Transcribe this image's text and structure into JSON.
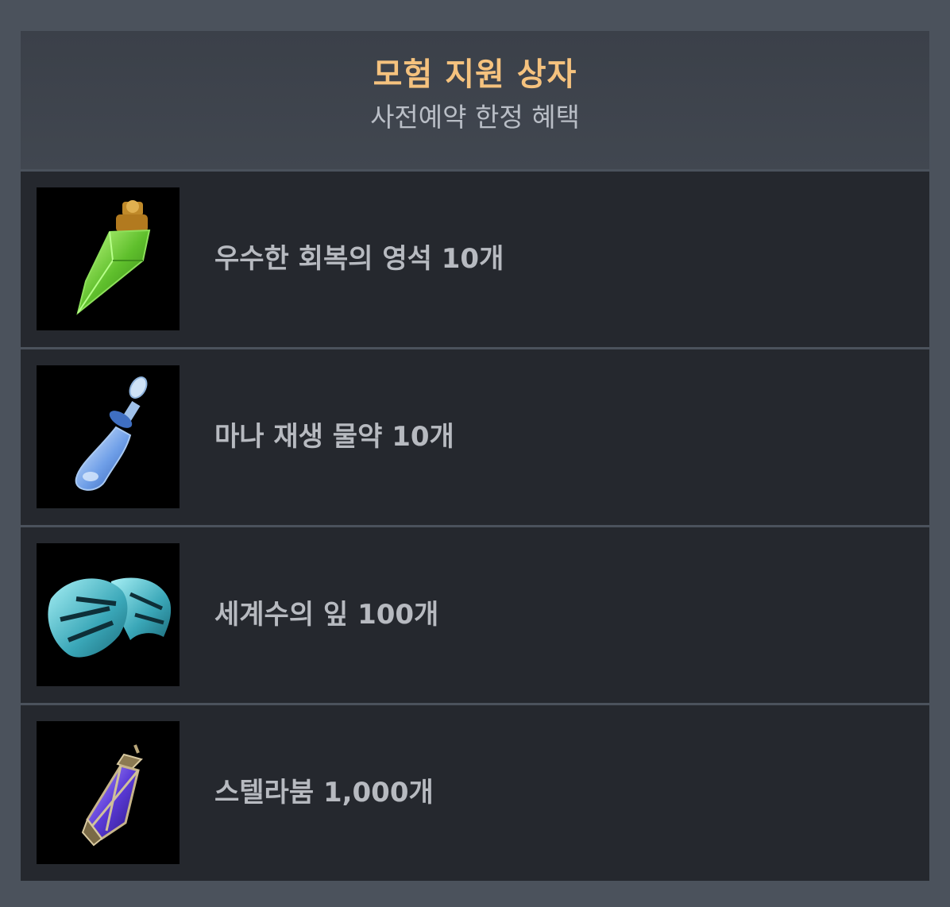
{
  "header": {
    "title": "모험 지원 상자",
    "subtitle": "사전예약 한정 혜택"
  },
  "items": [
    {
      "label": "우수한 회복의 영석 10개",
      "icon": "green-crystal-pendant-icon"
    },
    {
      "label": "마나 재생 물약 10개",
      "icon": "blue-potion-vial-icon"
    },
    {
      "label": "세계수의 잎 100개",
      "icon": "teal-leaf-icon"
    },
    {
      "label": "스텔라붐 1,000개",
      "icon": "purple-gem-lantern-icon"
    }
  ],
  "colors": {
    "title": "#f5c27e",
    "subtitle": "#b9bec6",
    "row_background": "#25282e",
    "page_background": "#4b525c"
  }
}
